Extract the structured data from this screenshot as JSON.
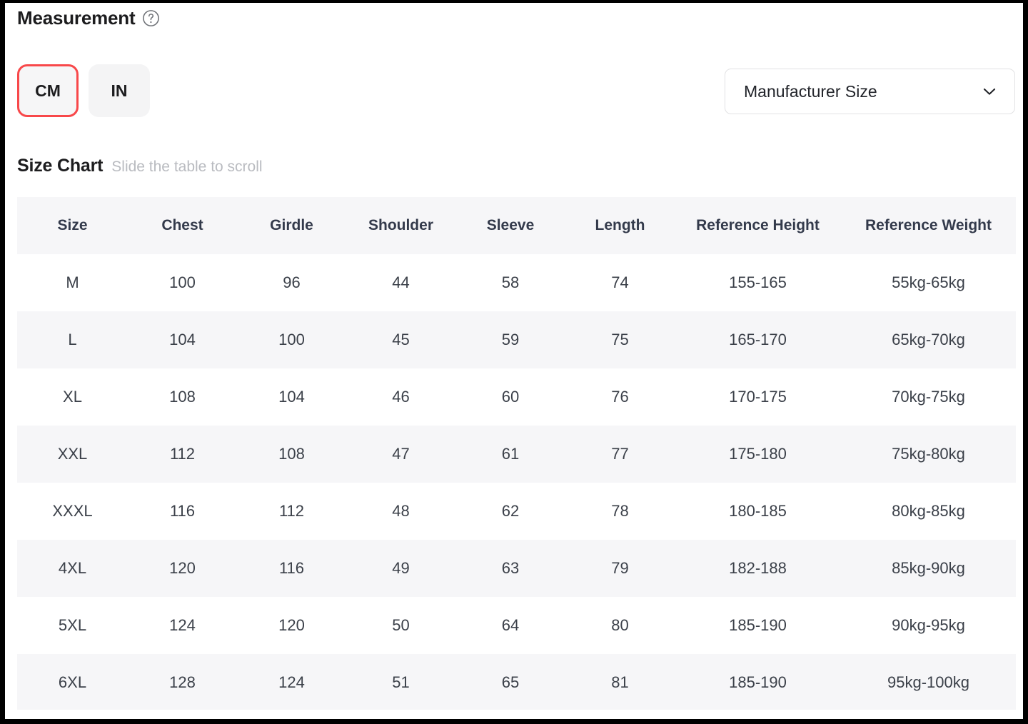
{
  "measurement": {
    "title": "Measurement",
    "help_icon": "question-circle-icon",
    "units": [
      {
        "label": "CM",
        "selected": true
      },
      {
        "label": "IN",
        "selected": false
      }
    ],
    "selected_unit": "CM",
    "accent_color": "#f8484a"
  },
  "size_type_select": {
    "value": "Manufacturer Size",
    "icon": "chevron-down-icon",
    "options": [
      "Manufacturer Size"
    ]
  },
  "size_chart": {
    "title": "Size Chart",
    "hint": "Slide the table to scroll",
    "columns": [
      "Size",
      "Chest",
      "Girdle",
      "Shoulder",
      "Sleeve",
      "Length",
      "Reference Height",
      "Reference Weight"
    ],
    "rows": [
      [
        "M",
        "100",
        "96",
        "44",
        "58",
        "74",
        "155-165",
        "55kg-65kg"
      ],
      [
        "L",
        "104",
        "100",
        "45",
        "59",
        "75",
        "165-170",
        "65kg-70kg"
      ],
      [
        "XL",
        "108",
        "104",
        "46",
        "60",
        "76",
        "170-175",
        "70kg-75kg"
      ],
      [
        "XXL",
        "112",
        "108",
        "47",
        "61",
        "77",
        "175-180",
        "75kg-80kg"
      ],
      [
        "XXXL",
        "116",
        "112",
        "48",
        "62",
        "78",
        "180-185",
        "80kg-85kg"
      ],
      [
        "4XL",
        "120",
        "116",
        "49",
        "63",
        "79",
        "182-188",
        "85kg-90kg"
      ],
      [
        "5XL",
        "124",
        "120",
        "50",
        "64",
        "80",
        "185-190",
        "90kg-95kg"
      ],
      [
        "6XL",
        "128",
        "124",
        "51",
        "65",
        "81",
        "185-190",
        "95kg-100kg"
      ]
    ]
  },
  "chart_data": {
    "type": "table",
    "title": "Size Chart",
    "unit": "CM",
    "size_system": "Manufacturer Size",
    "columns": [
      "Size",
      "Chest",
      "Girdle",
      "Shoulder",
      "Sleeve",
      "Length",
      "Reference Height",
      "Reference Weight"
    ],
    "categories": [
      "M",
      "L",
      "XL",
      "XXL",
      "XXXL",
      "4XL",
      "5XL",
      "6XL"
    ],
    "series": [
      {
        "name": "Chest",
        "values": [
          100,
          104,
          108,
          112,
          116,
          120,
          124,
          128
        ]
      },
      {
        "name": "Girdle",
        "values": [
          96,
          100,
          104,
          108,
          112,
          116,
          120,
          124
        ]
      },
      {
        "name": "Shoulder",
        "values": [
          44,
          45,
          46,
          47,
          48,
          49,
          50,
          51
        ]
      },
      {
        "name": "Sleeve",
        "values": [
          58,
          59,
          60,
          61,
          62,
          63,
          64,
          65
        ]
      },
      {
        "name": "Length",
        "values": [
          74,
          75,
          76,
          77,
          78,
          79,
          80,
          81
        ]
      },
      {
        "name": "Reference Height",
        "values": [
          "155-165",
          "165-170",
          "170-175",
          "175-180",
          "180-185",
          "182-188",
          "185-190",
          "185-190"
        ]
      },
      {
        "name": "Reference Weight",
        "values": [
          "55kg-65kg",
          "65kg-70kg",
          "70kg-75kg",
          "75kg-80kg",
          "80kg-85kg",
          "85kg-90kg",
          "90kg-95kg",
          "95kg-100kg"
        ]
      }
    ]
  }
}
